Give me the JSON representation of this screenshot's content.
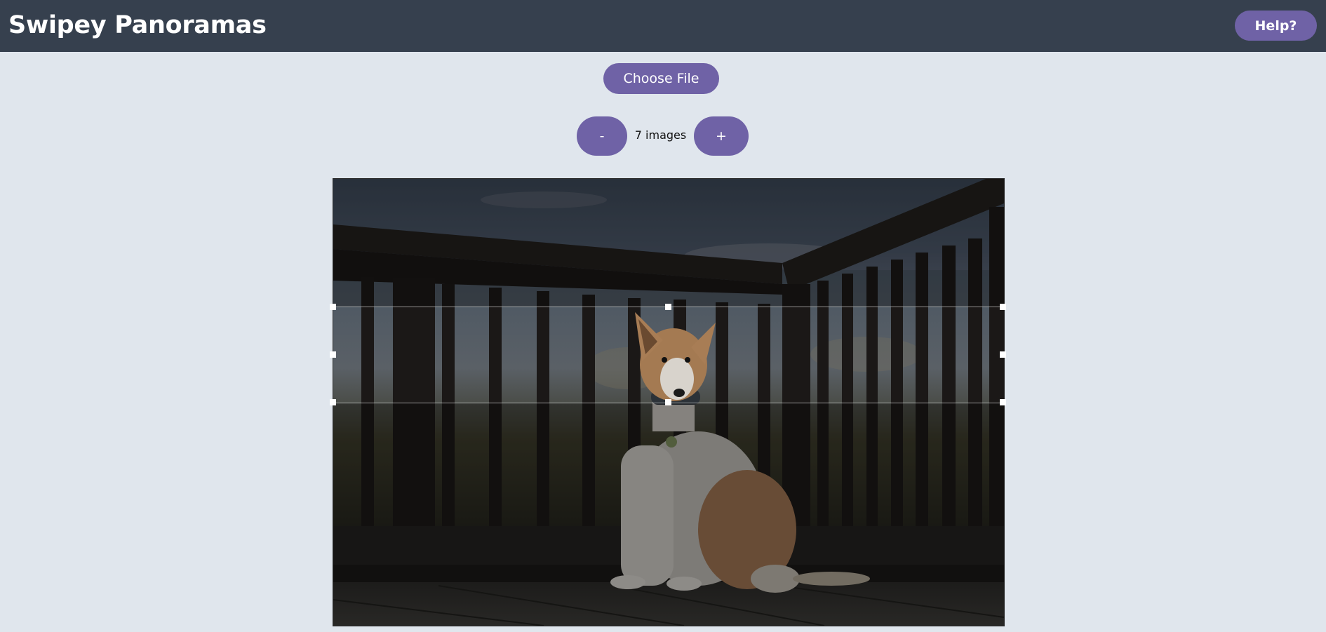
{
  "header": {
    "title": "Swipey Panoramas",
    "help_label": "Help?"
  },
  "file": {
    "choose_label": "Choose File"
  },
  "images": {
    "decrement_label": "-",
    "count_text": "7 images",
    "increment_label": "+"
  },
  "colors": {
    "header_bg": "#36404e",
    "accent": "#6f62a6",
    "page_bg": "#e0e6ed"
  }
}
